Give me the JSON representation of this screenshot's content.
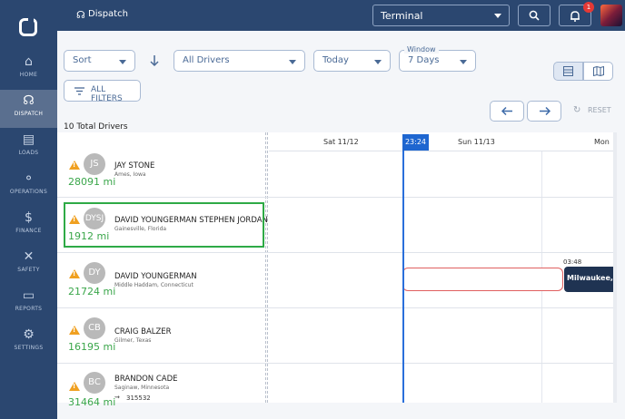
{
  "topbar": {
    "title": "Dispatch",
    "terminal_value": "Terminal",
    "notification_count": "1"
  },
  "sidebar": {
    "items": [
      {
        "label": "HOME",
        "icon": "home-icon"
      },
      {
        "label": "DISPATCH",
        "icon": "headset-icon"
      },
      {
        "label": "LOADS",
        "icon": "loads-icon"
      },
      {
        "label": "OPERATIONS",
        "icon": "operations-icon"
      },
      {
        "label": "FINANCE",
        "icon": "finance-icon"
      },
      {
        "label": "SAFETY",
        "icon": "tools-icon"
      },
      {
        "label": "REPORTS",
        "icon": "document-icon"
      },
      {
        "label": "SETTINGS",
        "icon": "gear-icon"
      }
    ]
  },
  "filters": {
    "sort": "Sort",
    "drivers": "All Drivers",
    "date": "Today",
    "window_label": "Window",
    "window_value": "7 Days",
    "all_filters": "ALL FILTERS"
  },
  "toolbar": {
    "reset": "RESET"
  },
  "summary": {
    "total": "10 Total Drivers"
  },
  "timeline": {
    "dates": [
      "Sat 11/12",
      "Sun 11/13",
      "Mon"
    ],
    "current_time": "23:24"
  },
  "drivers": [
    {
      "initials": "JS",
      "name": "JAY STONE",
      "location": "Ames, Iowa",
      "miles": "28091 mi"
    },
    {
      "initials": "DYSJ",
      "name": "DAVID YOUNGERMAN STEPHEN JORDAN",
      "location": "Gainesville, Florida",
      "miles": "1912 mi"
    },
    {
      "initials": "DY",
      "name": "DAVID YOUNGERMAN",
      "location": "Middle Haddam, Connecticut",
      "miles": "21724 mi"
    },
    {
      "initials": "CB",
      "name": "CRAIG BALZER",
      "location": "Gilmer, Texas",
      "miles": "16195 mi"
    },
    {
      "initials": "BC",
      "name": "BRANDON CADE",
      "location": "Saginaw, Minnesota",
      "miles": "31464 mi",
      "truck": "315532"
    }
  ],
  "loads": {
    "time": "03:48",
    "destination": "Milwaukee, WI"
  },
  "colors": {
    "sidebar": "#2b4770",
    "accent": "#2a6fdb",
    "miles": "#3aa64a",
    "highlight": "#2eaa46"
  }
}
